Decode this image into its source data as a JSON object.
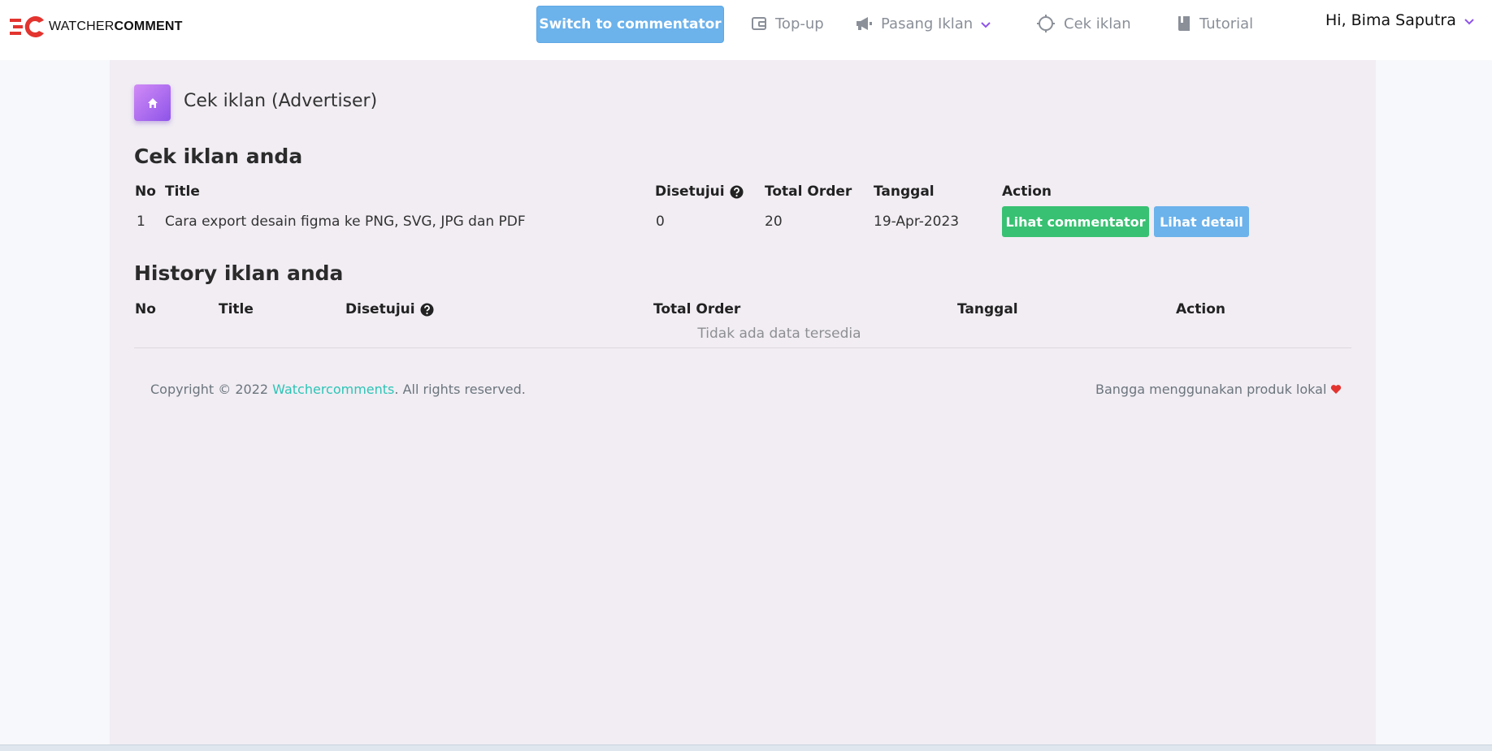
{
  "header": {
    "logo_prefix": "WATCHER",
    "logo_suffix": "COMMENT",
    "switch_label": "Switch to commentator",
    "nav": {
      "topup": "Top-up",
      "pasang_iklan": "Pasang Iklan",
      "cek_iklan": "Cek iklan",
      "tutorial": "Tutorial"
    },
    "user_greeting": "Hi, Bima Saputra"
  },
  "page": {
    "title": "Cek iklan (Advertiser)"
  },
  "active_ads": {
    "heading": "Cek iklan anda",
    "columns": {
      "no": "No",
      "title": "Title",
      "approved": "Disetujui",
      "total_order": "Total Order",
      "date": "Tanggal",
      "action": "Action"
    },
    "rows": [
      {
        "no": "1",
        "title": "Cara export desain figma ke PNG, SVG, JPG dan PDF",
        "approved": "0",
        "total_order": "20",
        "date": "19-Apr-2023",
        "btn_commentator": "Lihat commentator",
        "btn_detail": "Lihat detail"
      }
    ]
  },
  "history": {
    "heading": "History iklan anda",
    "columns": {
      "no": "No",
      "title": "Title",
      "approved": "Disetujui",
      "total_order": "Total Order",
      "date": "Tanggal",
      "action": "Action"
    },
    "empty_text": "Tidak ada data tersedia"
  },
  "footer": {
    "copyright_prefix": "Copyright © 2022 ",
    "brand_link": "Watchercomments",
    "copyright_suffix": ". All rights reserved.",
    "right_text": "Bangga menggunakan produk lokal"
  },
  "colors": {
    "primary_blue": "#6cb2eb",
    "success_green": "#38c172",
    "link_teal": "#2ec4b6",
    "heart_red": "#e3342f",
    "panel_bg": "#f1edf3",
    "accent_purple": "#8e54e9"
  },
  "icons": {
    "topup": "wallet-icon",
    "pasang_iklan": "megaphone-icon",
    "cek_iklan": "crosshair-icon",
    "tutorial": "book-icon",
    "home": "home-icon",
    "help": "question-circle-icon",
    "heart": "heart-icon",
    "chevron": "chevron-down-icon"
  }
}
